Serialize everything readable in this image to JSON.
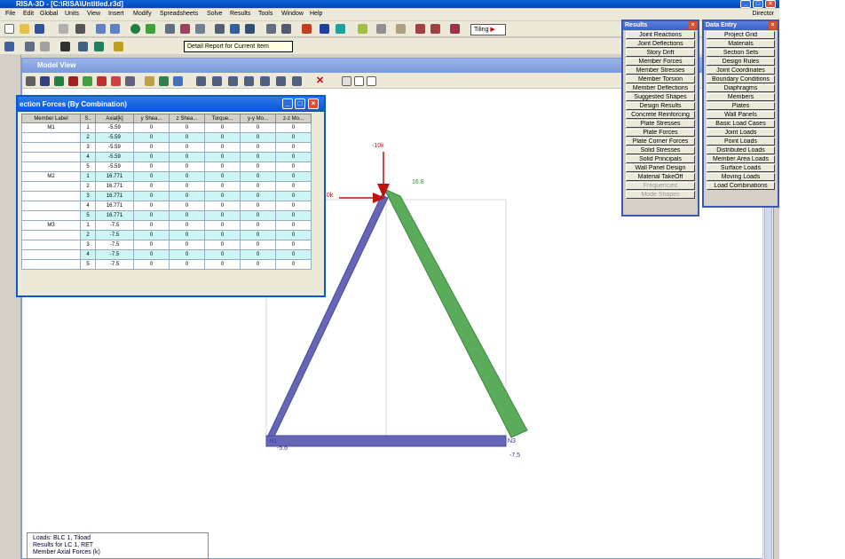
{
  "window": {
    "title": "RISA-3D - [C:\\RISA\\Untitled.r3d]"
  },
  "menu": {
    "items": [
      "File",
      "Edit",
      "Global",
      "Units",
      "View",
      "Insert",
      "Modify",
      "Spreadsheets",
      "Solve",
      "Results",
      "Tools",
      "Window",
      "Help"
    ],
    "right_label": "Director"
  },
  "toolbar": {
    "tiling_label": "Tiling",
    "tooltip": "Detail Report for Current Item"
  },
  "model_view": {
    "title": "Model View"
  },
  "section_forces": {
    "title": "ection Forces (By Combination)",
    "columns": [
      "Member Label",
      "S..",
      "Axial[k]",
      "y Shea...",
      "z Shea...",
      "Torque...",
      "y-y Mo...",
      "z-z Mo..."
    ],
    "rows": [
      {
        "label": "M1",
        "sec": "1",
        "axial": "-5.59",
        "ys": "0",
        "zs": "0",
        "torque": "0",
        "yy": "0",
        "zz": "0"
      },
      {
        "label": "",
        "sec": "2",
        "axial": "-5.59",
        "ys": "0",
        "zs": "0",
        "torque": "0",
        "yy": "0",
        "zz": "0"
      },
      {
        "label": "",
        "sec": "3",
        "axial": "-5.59",
        "ys": "0",
        "zs": "0",
        "torque": "0",
        "yy": "0",
        "zz": "0"
      },
      {
        "label": "",
        "sec": "4",
        "axial": "-5.59",
        "ys": "0",
        "zs": "0",
        "torque": "0",
        "yy": "0",
        "zz": "0"
      },
      {
        "label": "",
        "sec": "5",
        "axial": "-5.59",
        "ys": "0",
        "zs": "0",
        "torque": "0",
        "yy": "0",
        "zz": "0"
      },
      {
        "label": "M2",
        "sec": "1",
        "axial": "16.771",
        "ys": "0",
        "zs": "0",
        "torque": "0",
        "yy": "0",
        "zz": "0"
      },
      {
        "label": "",
        "sec": "2",
        "axial": "16.771",
        "ys": "0",
        "zs": "0",
        "torque": "0",
        "yy": "0",
        "zz": "0"
      },
      {
        "label": "",
        "sec": "3",
        "axial": "16.771",
        "ys": "0",
        "zs": "0",
        "torque": "0",
        "yy": "0",
        "zz": "0"
      },
      {
        "label": "",
        "sec": "4",
        "axial": "16.771",
        "ys": "0",
        "zs": "0",
        "torque": "0",
        "yy": "0",
        "zz": "0"
      },
      {
        "label": "",
        "sec": "5",
        "axial": "16.771",
        "ys": "0",
        "zs": "0",
        "torque": "0",
        "yy": "0",
        "zz": "0"
      },
      {
        "label": "M3",
        "sec": "1",
        "axial": "-7.5",
        "ys": "0",
        "zs": "0",
        "torque": "0",
        "yy": "0",
        "zz": "0"
      },
      {
        "label": "",
        "sec": "2",
        "axial": "-7.5",
        "ys": "0",
        "zs": "0",
        "torque": "0",
        "yy": "0",
        "zz": "0"
      },
      {
        "label": "",
        "sec": "3",
        "axial": "-7.5",
        "ys": "0",
        "zs": "0",
        "torque": "0",
        "yy": "0",
        "zz": "0"
      },
      {
        "label": "",
        "sec": "4",
        "axial": "-7.5",
        "ys": "0",
        "zs": "0",
        "torque": "0",
        "yy": "0",
        "zz": "0"
      },
      {
        "label": "",
        "sec": "5",
        "axial": "-7.5",
        "ys": "0",
        "zs": "0",
        "torque": "0",
        "yy": "0",
        "zz": "0"
      }
    ]
  },
  "drawing": {
    "load_vertical": "-10k",
    "load_horizontal": "10k",
    "m2_value": "16.8",
    "m1_value": "-5.6",
    "m3_value": "-7.5",
    "node_n3": "N3",
    "node_n1": "N1",
    "colors": {
      "compression": "#6666b8",
      "tension": "#5aab5a",
      "load": "#c01010"
    }
  },
  "results_panel": {
    "title": "Results",
    "buttons": [
      "Joint Reactions",
      "Joint Deflections",
      "Story Drift",
      "Member Forces",
      "Member Stresses",
      "Member Torsion",
      "Member Deflections",
      "Suggested Shapes",
      "Design Results",
      "Concrete Reinforcing",
      "Plate Stresses",
      "Plate Forces",
      "Plate Corner Forces",
      "Solid Stresses",
      "Solid Principals",
      "Wall Panel Design",
      "Material TakeOff"
    ],
    "disabled_buttons": [
      "Frequencies",
      "Mode Shapes"
    ]
  },
  "data_panel": {
    "title": "Data Entry",
    "buttons": [
      "Project Grid",
      "Materials",
      "Section Sets",
      "Design Rules",
      "Joint Coordinates",
      "Boundary Conditions",
      "Diaphragms",
      "Members",
      "Plates",
      "Wall Panels",
      "Basic Load Cases",
      "Joint Loads",
      "Point Loads",
      "Distributed Loads",
      "Member Area Loads",
      "Surface Loads",
      "Moving Loads",
      "Load Combinations"
    ]
  },
  "status": {
    "line1": "Loads: BLC 1, Tiload",
    "line2": "Results for LC 1, RET",
    "line3": "Member Axial Forces (k)"
  }
}
